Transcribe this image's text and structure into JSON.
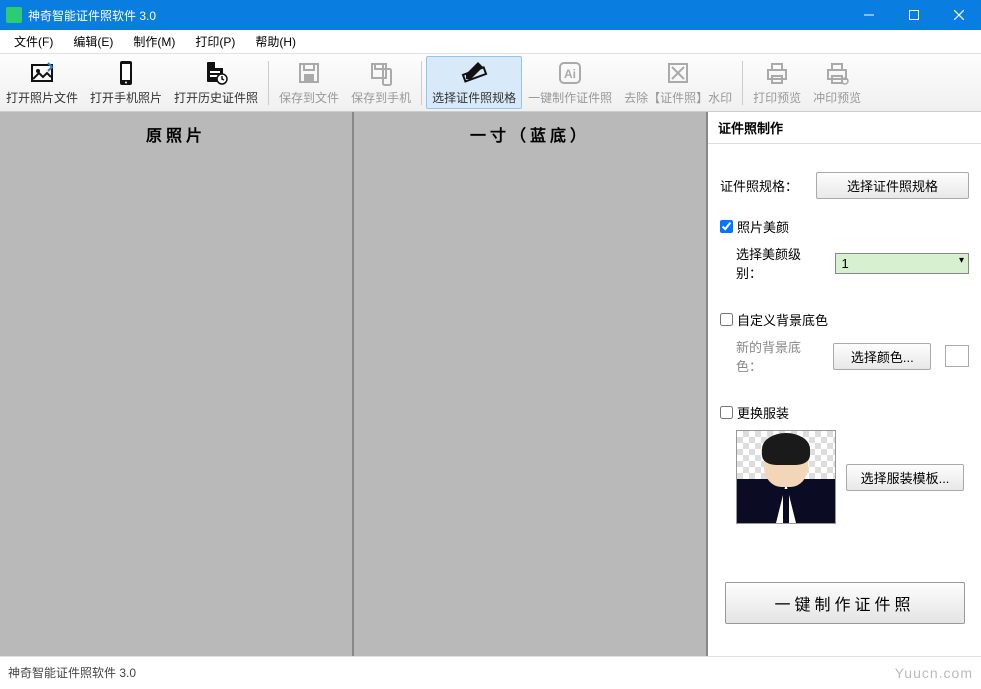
{
  "window": {
    "title": "神奇智能证件照软件 3.0",
    "icon_label": "神奇证件照"
  },
  "menubar": {
    "file": "文件(F)",
    "edit": "编辑(E)",
    "make": "制作(M)",
    "print": "打印(P)",
    "help": "帮助(H)"
  },
  "toolbar": {
    "open_file": "打开照片文件",
    "open_phone": "打开手机照片",
    "open_history": "打开历史证件照",
    "save_to_file": "保存到文件",
    "save_to_phone": "保存到手机",
    "select_spec": "选择证件照规格",
    "one_click_make": "一键制作证件照",
    "remove_idphoto": "去除【证件照】水印",
    "print_preview": "打印预览",
    "develop_preview": "冲印预览"
  },
  "panels": {
    "left_title": "原照片",
    "mid_title": "一寸（蓝底）"
  },
  "side": {
    "title": "证件照制作",
    "spec_label": "证件照规格：",
    "spec_button": "选择证件照规格",
    "beauty_check": "照片美颜",
    "beauty_checked": true,
    "beauty_level_label": "选择美颜级别：",
    "beauty_level_value": "1",
    "custom_bg_check": "自定义背景底色",
    "custom_bg_checked": false,
    "new_bg_label": "新的背景底色：",
    "pick_color_btn": "选择颜色...",
    "bg_color_value": "#ffffff",
    "change_clothes_check": "更换服装",
    "change_clothes_checked": false,
    "clothes_template_btn": "选择服装模板...",
    "big_button": "一键制作证件照"
  },
  "statusbar": {
    "text": "神奇智能证件照软件 3.0",
    "watermark": "Yuucn.com"
  }
}
